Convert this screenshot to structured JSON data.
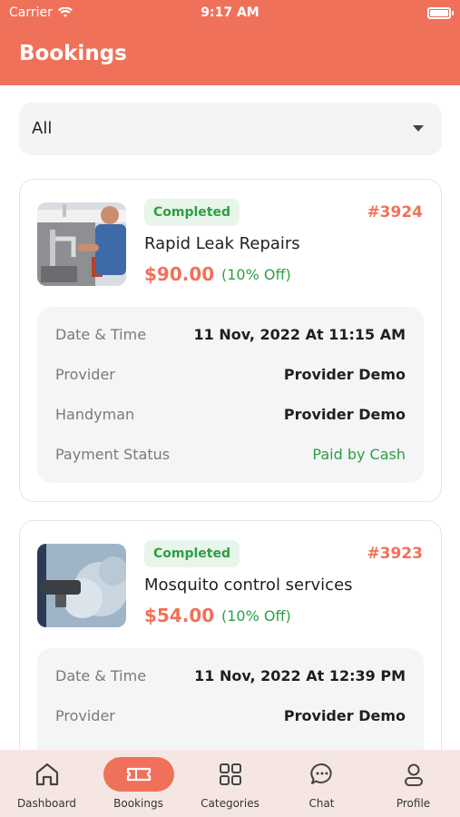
{
  "status_bar": {
    "carrier": "Carrier",
    "time": "9:17 AM"
  },
  "header": {
    "title": "Bookings"
  },
  "filter": {
    "selected": "All"
  },
  "bookings": [
    {
      "status": "Completed",
      "id": "#3924",
      "service": "Rapid Leak Repairs",
      "price": "$90.00",
      "discount": "(10% Off)",
      "details": [
        {
          "label": "Date & Time",
          "value": "11 Nov, 2022 At 11:15 AM"
        },
        {
          "label": "Provider",
          "value": "Provider Demo"
        },
        {
          "label": "Handyman",
          "value": "Provider Demo"
        },
        {
          "label": "Payment Status",
          "value": "Paid by Cash"
        }
      ]
    },
    {
      "status": "Completed",
      "id": "#3923",
      "service": "Mosquito control services",
      "price": "$54.00",
      "discount": "(10% Off)",
      "details": [
        {
          "label": "Date & Time",
          "value": "11 Nov, 2022 At 12:39 PM"
        },
        {
          "label": "Provider",
          "value": "Provider Demo"
        }
      ]
    }
  ],
  "nav": {
    "items": [
      {
        "label": "Dashboard",
        "icon": "home-icon"
      },
      {
        "label": "Bookings",
        "icon": "ticket-icon",
        "active": true
      },
      {
        "label": "Categories",
        "icon": "grid-icon"
      },
      {
        "label": "Chat",
        "icon": "chat-icon"
      },
      {
        "label": "Profile",
        "icon": "user-icon"
      }
    ]
  },
  "colors": {
    "primary": "#f0715a",
    "success": "#2e9e44",
    "nav_bg": "#f6e6e3"
  }
}
